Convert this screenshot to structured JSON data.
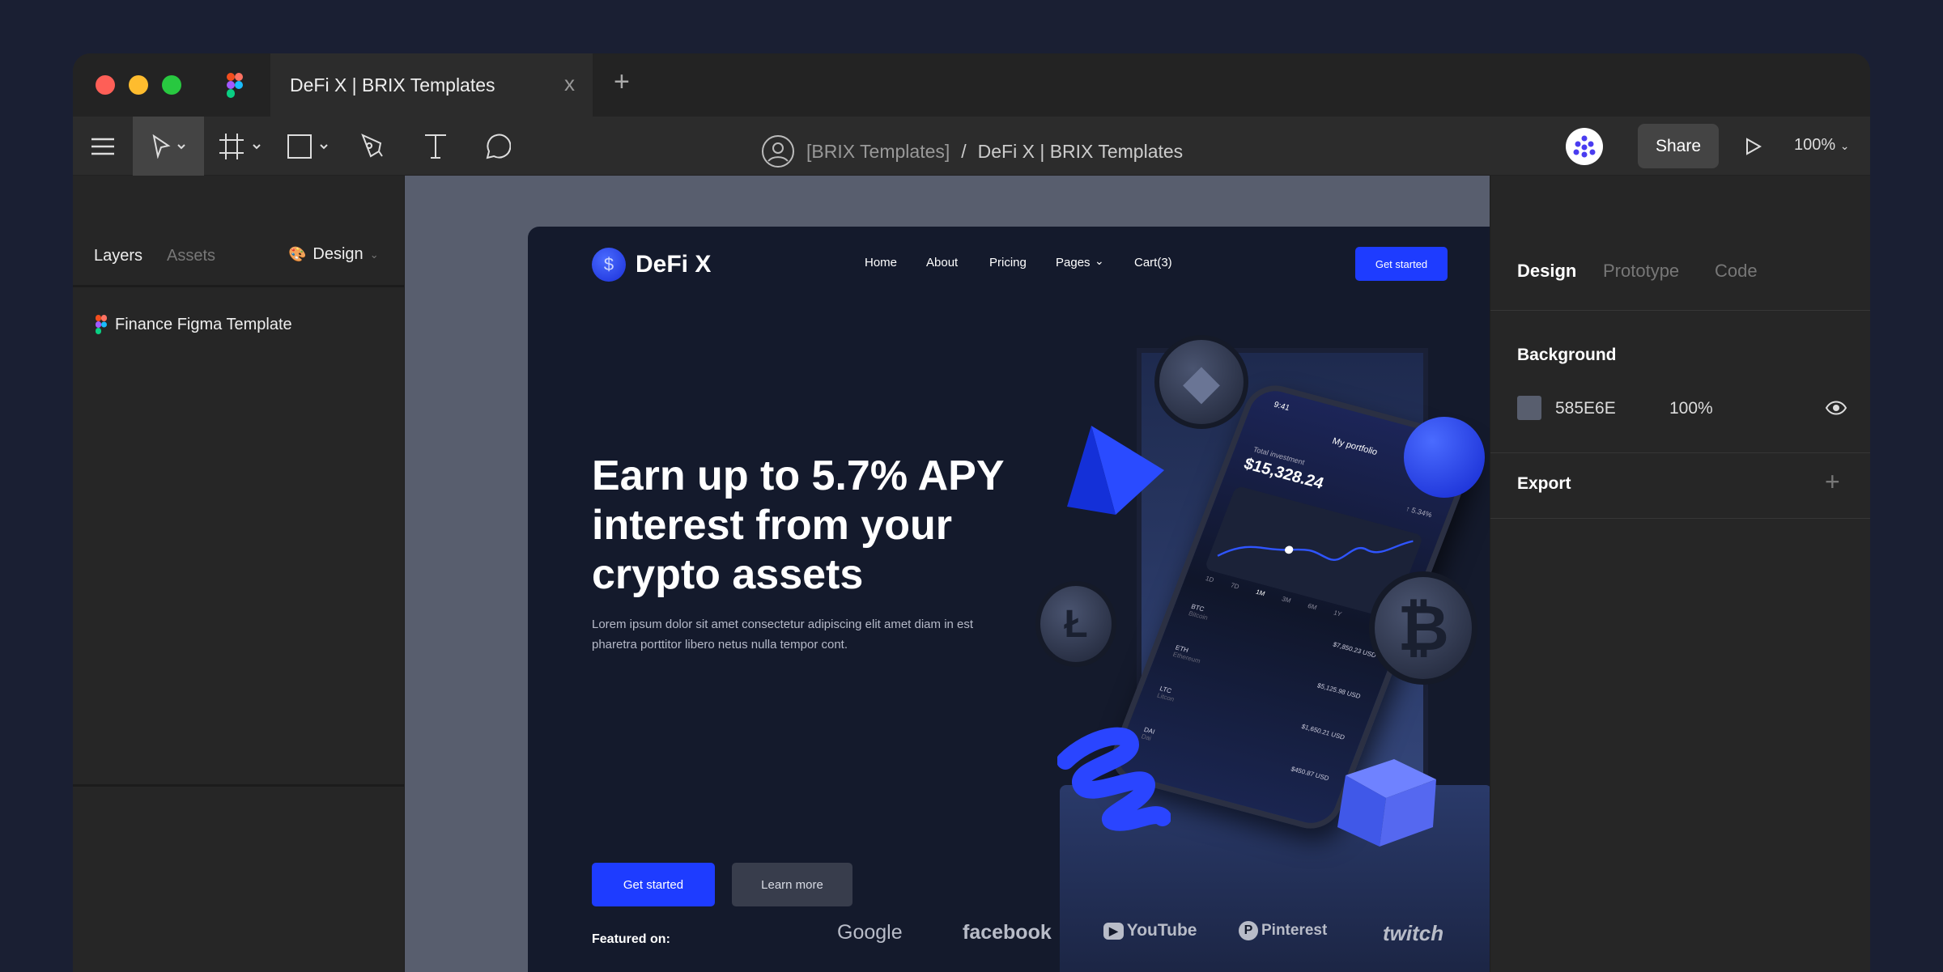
{
  "browser": {
    "tab_title": "DeFi X | BRIX Templates",
    "close": "x",
    "new_tab": "+"
  },
  "toolbar": {
    "breadcrumb_team": "[BRIX Templates]",
    "breadcrumb_sep": "/",
    "breadcrumb_file": "DeFi X | BRIX Templates",
    "share": "Share",
    "zoom": "100%"
  },
  "left_panel": {
    "tabs": [
      "Layers",
      "Assets"
    ],
    "page_select": "Design",
    "layers": [
      {
        "name": "Finance Figma Template"
      }
    ]
  },
  "right_panel": {
    "tabs": [
      "Design",
      "Prototype",
      "Code"
    ],
    "background_label": "Background",
    "bg_color": "585E6E",
    "bg_opacity": "100%",
    "export_label": "Export",
    "export_add": "+"
  },
  "site": {
    "brand": "DeFi X",
    "brand_icon": "$",
    "nav": [
      "Home",
      "About",
      "Pricing",
      "Pages",
      "Cart(3)"
    ],
    "nav_cta": "Get started",
    "headline": "Earn up to 5.7% APY interest from your crypto assets",
    "paragraph": "Lorem ipsum dolor sit amet consectetur adipiscing elit amet diam in est pharetra porttitor libero netus nulla tempor cont.",
    "primary_cta": "Get started",
    "secondary_cta": "Learn more",
    "featured_label": "Featured on:",
    "featured_logos": [
      "Google",
      "facebook",
      "YouTube",
      "Pinterest",
      "twitch"
    ],
    "accent": "#1e3cff"
  },
  "phone": {
    "time": "9:41",
    "title": "My portfolio",
    "total_label": "Total investment",
    "total": "$15,328.24",
    "change": "↑ 5.34%",
    "ranges": [
      "1D",
      "7D",
      "1M",
      "3M",
      "6M",
      "1Y"
    ],
    "assets": [
      {
        "sym": "BTC",
        "name": "Bitcoin",
        "value": "$7,850.23 USD"
      },
      {
        "sym": "ETH",
        "name": "Ethereum",
        "value": "$5,125.98 USD"
      },
      {
        "sym": "LTC",
        "name": "Litcon",
        "value": "$1,650.21 USD"
      },
      {
        "sym": "DAI",
        "name": "Dai",
        "value": "$450.87 USD"
      }
    ]
  }
}
